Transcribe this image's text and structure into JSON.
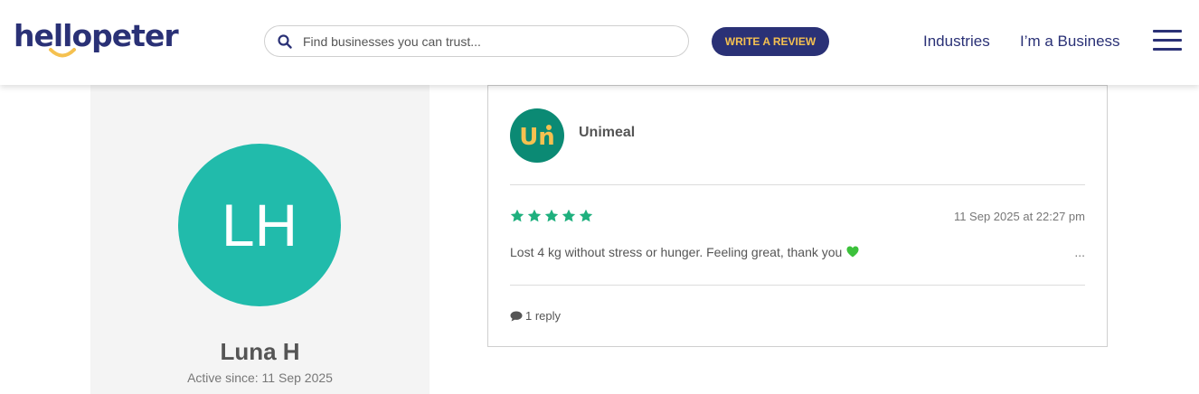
{
  "header": {
    "logo_text": "hellopeter",
    "search": {
      "placeholder": "Find businesses you can trust..."
    },
    "write_review_label": "WRITE A REVIEW",
    "nav": {
      "industries": "Industries",
      "business": "I’m a Business"
    }
  },
  "profile": {
    "initials": "LH",
    "name": "Luna H",
    "active_since": "Active since: 11 Sep 2025",
    "avatar_color": "#21bbab"
  },
  "review": {
    "business_name": "Unimeal",
    "business_logo_text": "Un",
    "rating": 5,
    "date": "11 Sep 2025 at 22:27 pm",
    "text": "Lost 4 kg without stress or hunger. Feeling great, thank you",
    "more": "...",
    "replies": "1 reply"
  },
  "colors": {
    "brand_navy": "#2a3176",
    "brand_yellow": "#f5c150",
    "star_green": "#1fb07e",
    "logo_bg": "#0b8a74"
  }
}
